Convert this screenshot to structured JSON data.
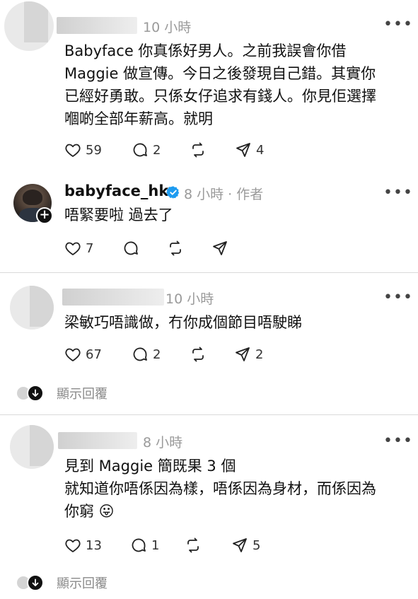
{
  "comments": [
    {
      "time": "10 小時",
      "lines": [
        "Babyface 你真係好男人。之前我誤會你借",
        "Maggie 做宣傳。今日之後發現自己錯。其實你",
        "已經好勇敢。只係女仔追求有錢人。你見佢選擇",
        "嗰啲全部年薪高。就明"
      ],
      "likes": "59",
      "replies": "2",
      "shares": "4"
    },
    {
      "username": "babyface_hk",
      "meta": "8 小時 · 作者",
      "lines": [
        "唔緊要啦 過去了"
      ],
      "likes": "7"
    },
    {
      "time": "10 小時",
      "lines": [
        "梁敏巧唔識做，冇你成個節目唔駛睇"
      ],
      "likes": "67",
      "replies": "2",
      "shares": "2",
      "show_replies": "顯示回覆"
    },
    {
      "time": "8 小時",
      "lines": [
        "見到 Maggie 簡既果 3 個",
        "就知道你唔係因為樣，唔係因為身材，而係因為",
        "你窮 😛"
      ],
      "likes": "13",
      "replies": "1",
      "shares": "5",
      "show_replies": "顯示回覆"
    }
  ],
  "icons": {
    "like": "heart-icon",
    "reply": "comment-icon",
    "repost": "repost-icon",
    "share": "send-icon",
    "more": "more-icon",
    "verified": "verified-badge-icon",
    "follow": "plus-icon"
  },
  "colors": {
    "verified": "#1d9bf0",
    "muted_text": "#9a9a9a",
    "divider": "#d9d9d9"
  }
}
